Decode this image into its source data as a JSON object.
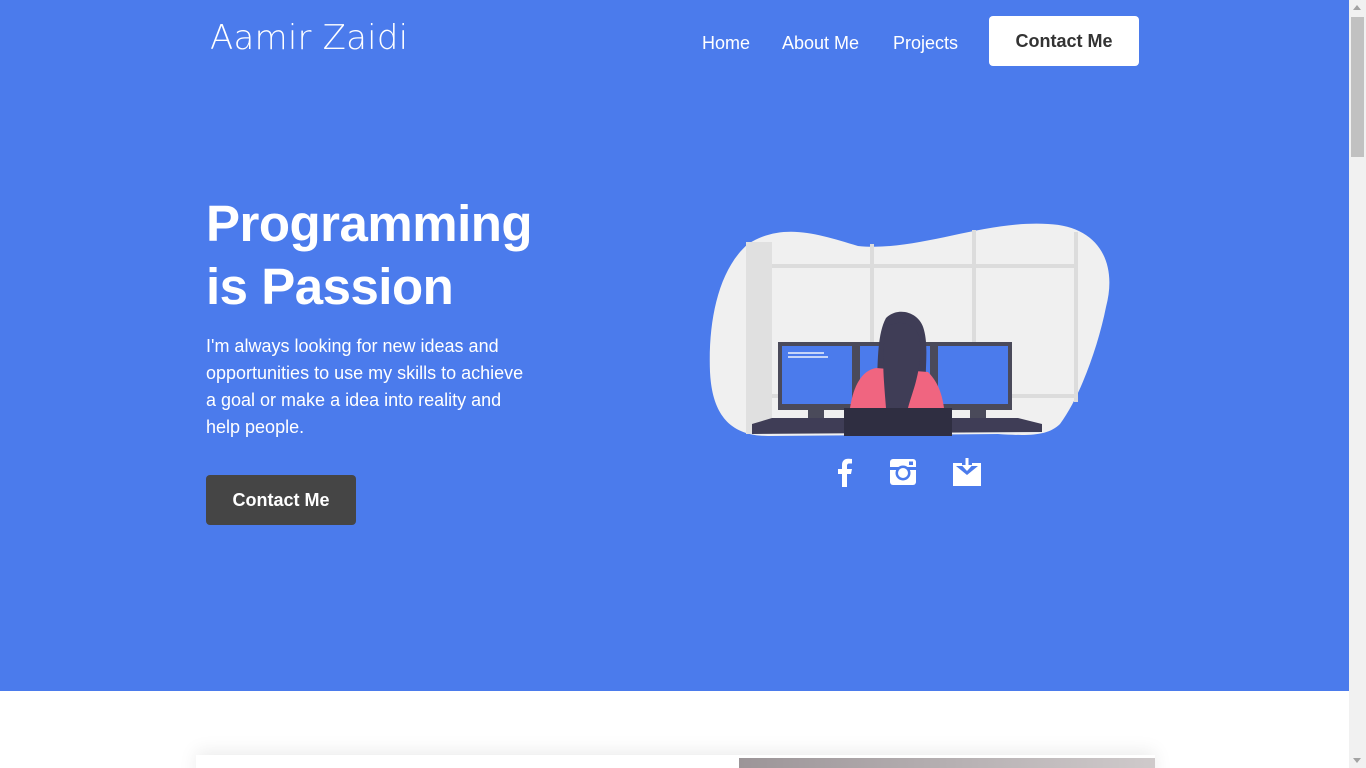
{
  "colors": {
    "hero_bg": "#4b7bec",
    "primary_button_bg": "#454545",
    "nav_button_bg": "#ffffff",
    "text_light": "#ffffff"
  },
  "header": {
    "logo": "Aamir Zaidi",
    "nav": [
      {
        "label": "Home"
      },
      {
        "label": "About Me"
      },
      {
        "label": "Projects"
      }
    ],
    "cta_label": "Contact Me"
  },
  "hero": {
    "title_line1": "Programming",
    "title_line2": "is Passion",
    "description": "I'm always looking for new ideas and opportunities to use my skills to achieve a goal or make a idea into reality and help people.",
    "cta_label": "Contact Me",
    "illustration": "developer-at-three-monitors",
    "social_icons": [
      "facebook-icon",
      "instagram-icon",
      "download-mail-icon"
    ]
  }
}
